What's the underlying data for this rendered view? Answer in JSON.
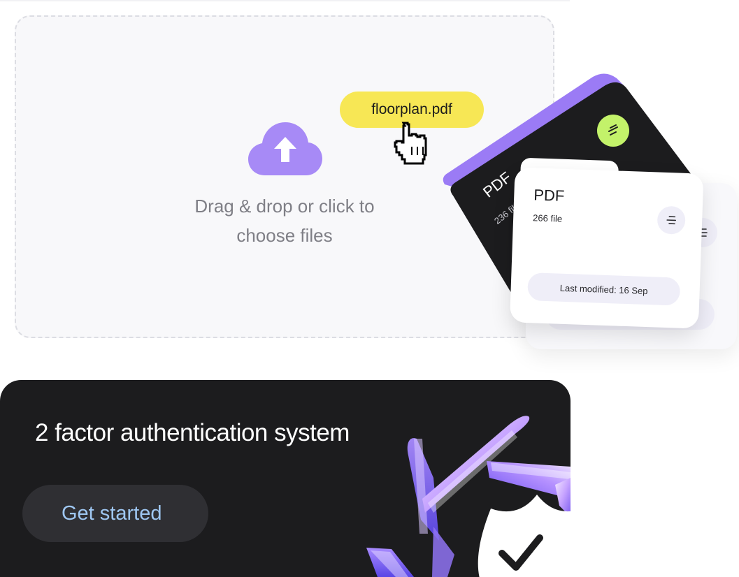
{
  "upload": {
    "instruction_line1": "Drag & drop or click to",
    "instruction_line2": "choose files",
    "dragged_file": "floorplan.pdf",
    "icon": "cloud-upload-icon",
    "accent_color": "#a78af6",
    "file_pill_color": "#f7e755"
  },
  "folders": {
    "back": {
      "title": "PDF",
      "count": "236 file",
      "button_icon": "lines-icon",
      "button_color": "#c3f26a",
      "tab_color": "#9b7bf5"
    },
    "front": {
      "title": "PDF",
      "count": "266 file",
      "menu_icon": "menu-lines-icon",
      "modified": "Last modified: 16 Sep"
    }
  },
  "banner": {
    "title": "2 factor authentication system",
    "cta": "Get started",
    "cta_color": "#9fc7f2",
    "badge_icon": "shield-check-icon"
  }
}
